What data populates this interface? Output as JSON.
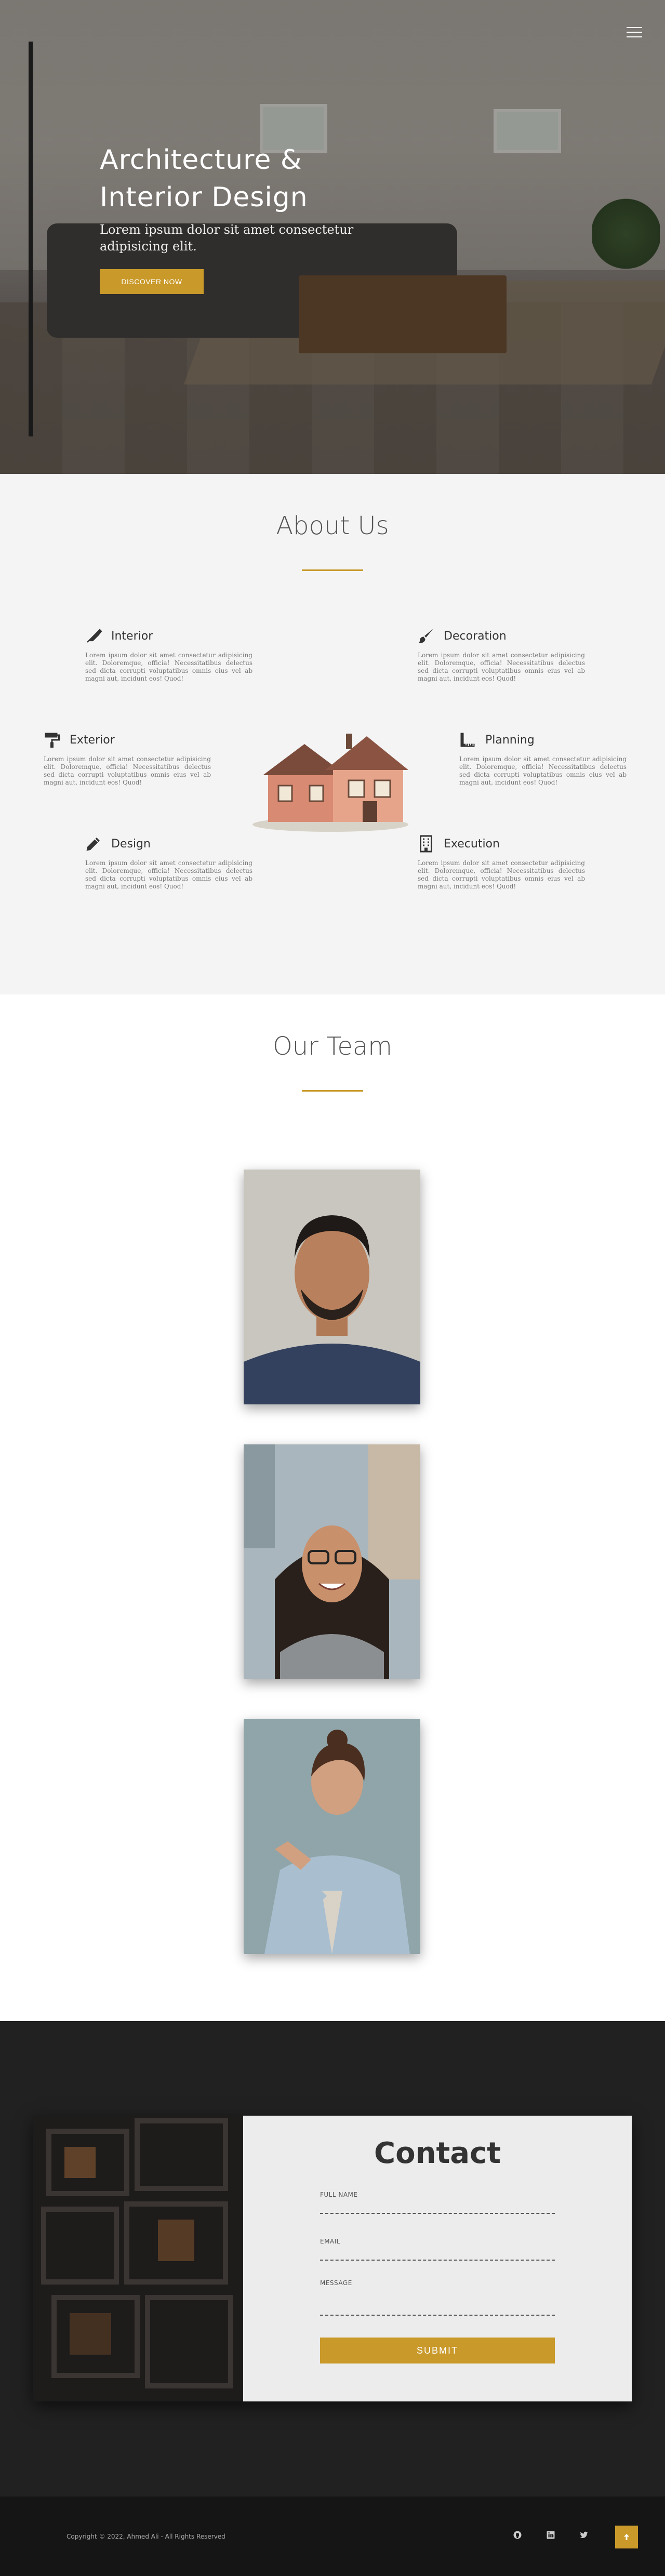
{
  "hero": {
    "title_line1": "Architecture &",
    "title_line2": "Interior Design",
    "subtitle": "Lorem ipsum dolor sit amet consectetur adipisicing elit.",
    "button": "DISCOVER NOW",
    "menu_icon": "hamburger-menu-icon"
  },
  "about": {
    "title": "About Us",
    "features": [
      {
        "title": "Interior",
        "icon": "pen-nib-icon",
        "text": "Lorem ipsum dolor sit amet consectetur adipisicing elit. Doloremque, officia! Necessitatibus delectus sed dicta corrupti voluptatibus omnis eius vel ab magni aut, incidunt eos! Quod!"
      },
      {
        "title": "Decoration",
        "icon": "paint-brush-icon",
        "text": "Lorem ipsum dolor sit amet consectetur adipisicing elit. Doloremque, officia! Necessitatibus delectus sed dicta corrupti voluptatibus omnis eius vel ab magni aut, incidunt eos! Quod!"
      },
      {
        "title": "Exterior",
        "icon": "paint-roller-icon",
        "text": "Lorem ipsum dolor sit amet consectetur adipisicing elit. Doloremque, officia! Necessitatibus delectus sed dicta corrupti voluptatibus omnis eius vel ab magni aut, incidunt eos! Quod!"
      },
      {
        "title": "Planning",
        "icon": "ruler-icon",
        "text": "Lorem ipsum dolor sit amet consectetur adipisicing elit. Doloremque, officia! Necessitatibus delectus sed dicta corrupti voluptatibus omnis eius vel ab magni aut, incidunt eos! Quod!"
      },
      {
        "title": "Design",
        "icon": "pencil-icon",
        "text": "Lorem ipsum dolor sit amet consectetur adipisicing elit. Doloremque, officia! Necessitatibus delectus sed dicta corrupti voluptatibus omnis eius vel ab magni aut, incidunt eos! Quod!"
      },
      {
        "title": "Execution",
        "icon": "building-icon",
        "text": "Lorem ipsum dolor sit amet consectetur adipisicing elit. Doloremque, officia! Necessitatibus delectus sed dicta corrupti voluptatibus omnis eius vel ab magni aut, incidunt eos! Quod!"
      }
    ]
  },
  "team": {
    "title": "Our Team"
  },
  "contact": {
    "title": "Contact",
    "name_label": "FULL NAME",
    "email_label": "EMAIL",
    "message_label": "MESSAGE",
    "submit": "SUBMIT"
  },
  "footer": {
    "copyright": "Copyright © 2022, Ahmed Ali - All Rights Reserved",
    "social_icons": [
      "github-icon",
      "linkedin-icon",
      "twitter-icon"
    ],
    "to_top_icon": "arrow-up-icon"
  },
  "colors": {
    "accent": "#c9992a",
    "dark": "#212121",
    "footer": "#151515"
  }
}
